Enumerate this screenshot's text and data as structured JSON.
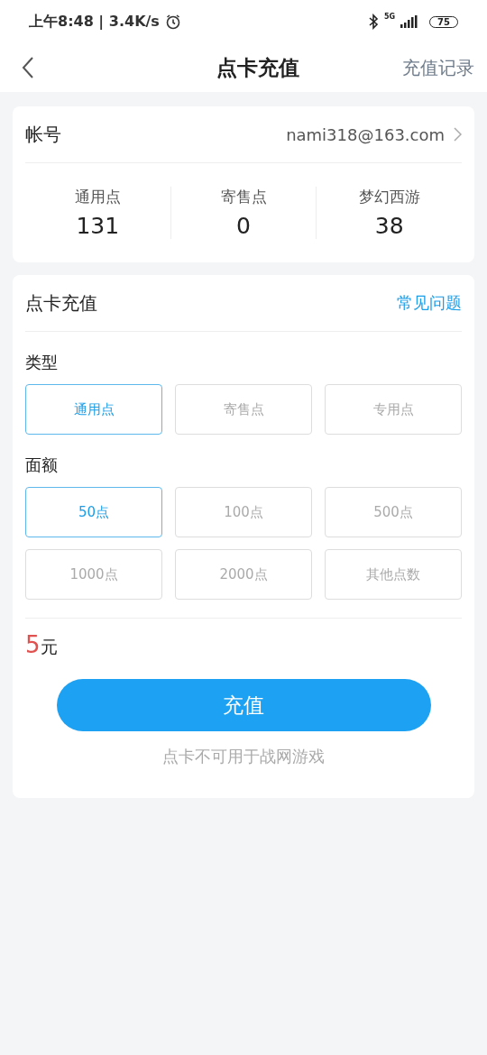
{
  "status_bar": {
    "time": "上午8:48 | 3.4K/s",
    "network": "5G",
    "battery": "75"
  },
  "header": {
    "title": "点卡充值",
    "action": "充值记录"
  },
  "account": {
    "label": "帐号",
    "value": "nami318@163.com",
    "balances": [
      {
        "label": "通用点",
        "value": "131"
      },
      {
        "label": "寄售点",
        "value": "0"
      },
      {
        "label": "梦幻西游",
        "value": "38"
      }
    ]
  },
  "recharge": {
    "title": "点卡充值",
    "help": "常见问题",
    "type_label": "类型",
    "types": [
      {
        "label": "通用点",
        "selected": true
      },
      {
        "label": "寄售点",
        "selected": false
      },
      {
        "label": "专用点",
        "selected": false
      }
    ],
    "amount_label": "面额",
    "amounts": [
      {
        "label": "50点",
        "selected": true
      },
      {
        "label": "100点",
        "selected": false
      },
      {
        "label": "500点",
        "selected": false
      },
      {
        "label": "1000点",
        "selected": false
      },
      {
        "label": "2000点",
        "selected": false
      },
      {
        "label": "其他点数",
        "selected": false
      }
    ],
    "price": {
      "amount": "5",
      "unit": "元"
    },
    "button": "充值",
    "note": "点卡不可用于战网游戏"
  }
}
